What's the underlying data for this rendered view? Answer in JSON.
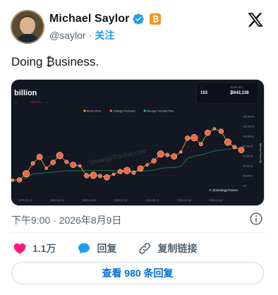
{
  "author": {
    "name": "Michael Saylor",
    "handle": "@saylor",
    "separator": "·",
    "follow_label": "关注",
    "btc_badge": "₿"
  },
  "tweet": {
    "text": "Doing ₿usiness."
  },
  "media": {
    "title": "billion",
    "stats": [
      "—",
      "+16.27%",
      "—"
    ],
    "stat_colors": [
      "#c7cbd6",
      "#f23645",
      "#8b93a7"
    ],
    "legend": [
      {
        "label": "Bitcoin Price",
        "color": "#f7931a"
      },
      {
        "label": "Strategy Purchases",
        "color": "#ff6b3d"
      },
      {
        "label": "Average Purchase Price",
        "color": "#22c55e"
      }
    ],
    "panel": {
      "headers": [
        "—",
        "TOTAL BTC"
      ],
      "values": [
        "153",
        "₿642,138"
      ],
      "subs": [
        "—",
        "—"
      ]
    },
    "watermark": "StrategyTracker.com",
    "credit": "✕ @StrategyTracker",
    "y_axis_label": "Bitcoin Price ($)",
    "y_ticks": [
      "140,000 $",
      "120,000 $",
      "100,000 $",
      "80,000 $",
      "60,000 $",
      "40,000 $",
      "20,000 $",
      "0 $"
    ],
    "x_ticks": [
      "2021-01-11",
      "2022-03-09",
      "2022-11-09",
      "2023-07-11",
      "2024-05-11",
      "2025-02-08",
      "2025-11-10"
    ]
  },
  "meta": {
    "timestamp": "下午9:00 · 2026年8月9日"
  },
  "actions": {
    "like_count": "1.1万",
    "reply_label": "回复",
    "copy_link_label": "复制链接"
  },
  "replies_button": "查看 980 条回复",
  "colors": {
    "accent": "#1d9bf0",
    "like": "#f91880",
    "text_secondary": "#536471",
    "bitcoin": "#f7931a"
  },
  "chart_data": {
    "type": "line",
    "x": [
      "2020-08",
      "2020-10",
      "2020-12",
      "2021-02",
      "2021-04",
      "2021-06",
      "2021-08",
      "2021-10",
      "2021-12",
      "2022-02",
      "2022-04",
      "2022-06",
      "2022-08",
      "2022-10",
      "2022-12",
      "2023-02",
      "2023-04",
      "2023-06",
      "2023-08",
      "2023-10",
      "2023-12",
      "2024-02",
      "2024-04",
      "2024-06",
      "2024-08",
      "2024-10",
      "2024-12",
      "2025-02",
      "2025-04",
      "2025-06",
      "2025-08",
      "2025-10",
      "2025-12",
      "2026-02",
      "2026-04"
    ],
    "series": [
      {
        "name": "Bitcoin Price",
        "values": [
          11000,
          11500,
          24000,
          45000,
          58000,
          35000,
          47000,
          61000,
          48000,
          42000,
          40000,
          20000,
          21000,
          19500,
          16800,
          23000,
          28500,
          30500,
          26000,
          34500,
          42000,
          50000,
          64000,
          62000,
          59000,
          68000,
          96000,
          97000,
          84000,
          107000,
          115000,
          110000,
          88000,
          78000,
          72000
        ]
      },
      {
        "name": "Average Purchase Price",
        "values": [
          11000,
          11500,
          15000,
          24000,
          25000,
          26000,
          27000,
          29000,
          30000,
          30200,
          30300,
          30500,
          30600,
          30600,
          30400,
          30000,
          29800,
          29700,
          29600,
          29600,
          30000,
          31000,
          35000,
          36000,
          36500,
          38500,
          55000,
          60000,
          62000,
          66000,
          70000,
          72000,
          74000,
          75000,
          76000
        ]
      }
    ],
    "ylabel": "Bitcoin Price ($)",
    "ylim": [
      0,
      140000
    ],
    "grid": true,
    "legend_position": "top-center"
  }
}
